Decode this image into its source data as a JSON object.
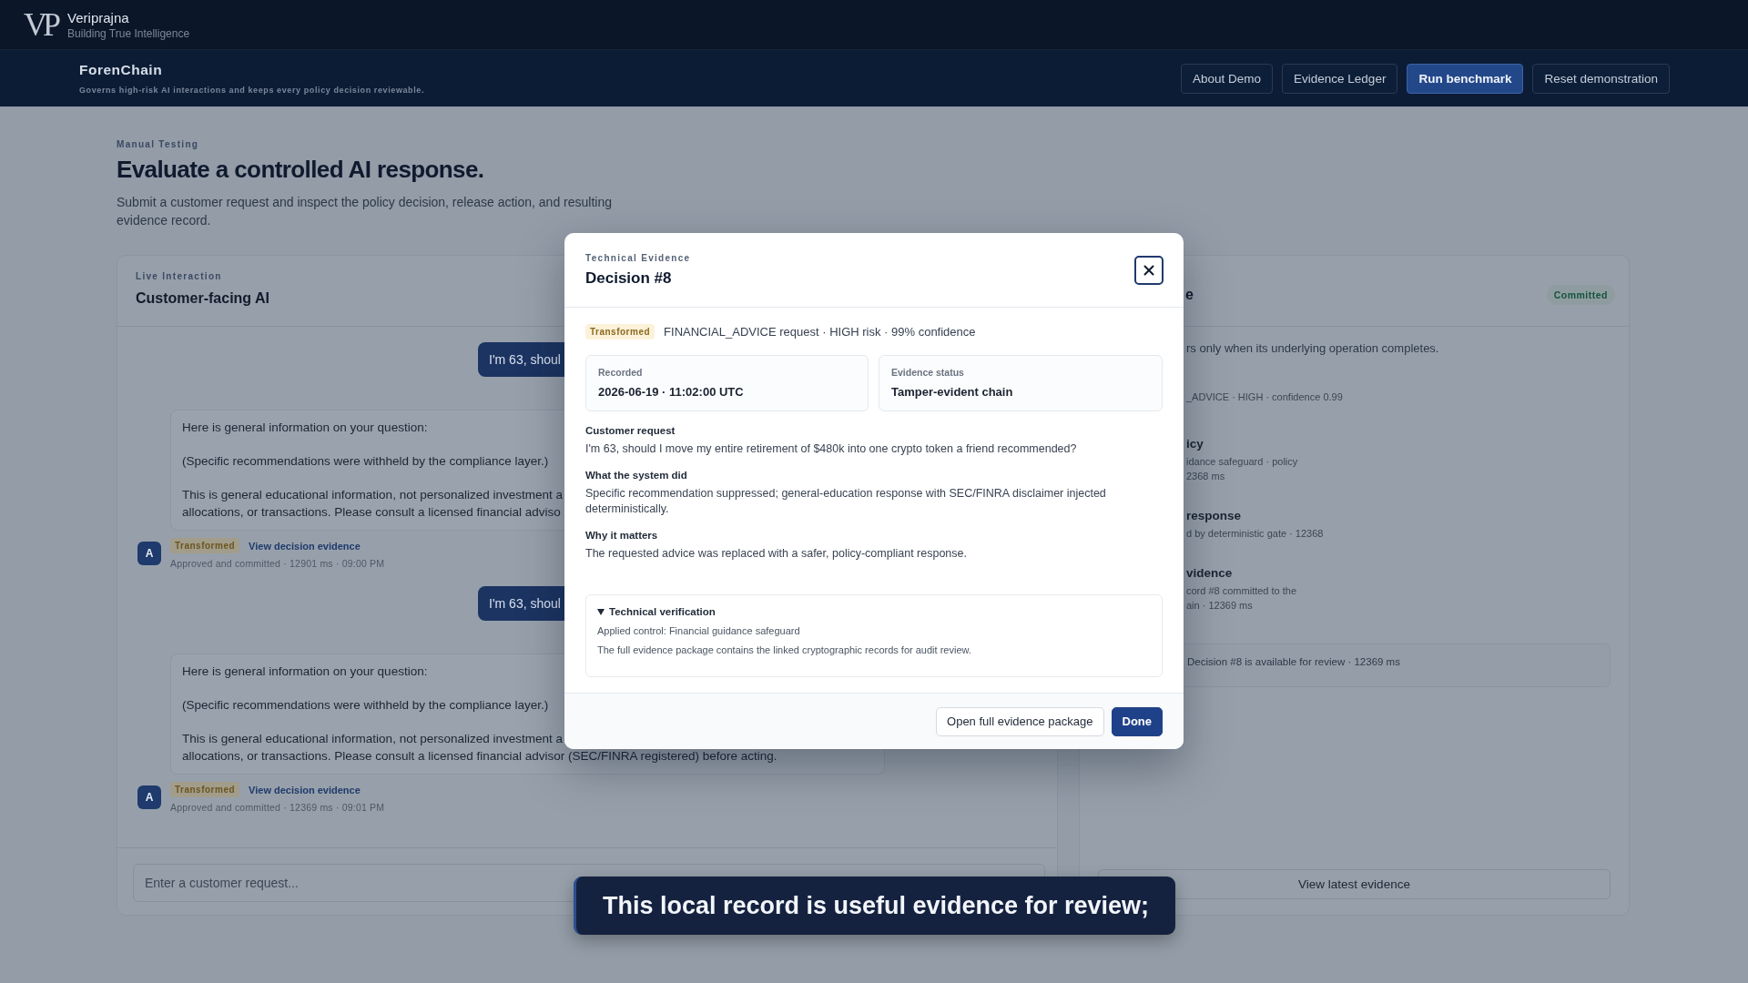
{
  "brand": {
    "logo": "VP",
    "name": "Veriprajna",
    "tagline": "Building True Intelligence"
  },
  "app": {
    "name": "ForenChain",
    "tagline": "Governs high-risk AI interactions and keeps every policy decision reviewable.",
    "buttons": [
      {
        "label": "About Demo",
        "primary": false
      },
      {
        "label": "Evidence Ledger",
        "primary": false
      },
      {
        "label": "Run benchmark",
        "primary": true
      },
      {
        "label": "Reset demonstration",
        "primary": false
      }
    ]
  },
  "page": {
    "eyebrow": "Manual Testing",
    "title": "Evaluate a controlled AI response.",
    "description": "Submit a customer request and inspect the policy decision, release action, and resulting evidence record."
  },
  "chat": {
    "eyebrow": "Live Interaction",
    "title": "Customer-facing AI",
    "messages": [
      {
        "kind": "user",
        "text": "I'm 63, shoul"
      },
      {
        "kind": "assistant",
        "paragraphs": [
          [
            "Here is general information on your question:"
          ],
          [
            "(Specific recommendations were withheld by the compliance layer.)"
          ],
          [
            "This is general educational information, not personalized investment a",
            "allocations, or transactions. Please consult a licensed financial adviso"
          ]
        ],
        "avatar": "A",
        "badge": "Transformed",
        "link": "View decision evidence",
        "meta": "Approved and committed · 12901 ms · 09:00 PM"
      },
      {
        "kind": "user",
        "text": "I'm 63, shoul"
      },
      {
        "kind": "assistant",
        "paragraphs": [
          [
            "Here is general information on your question:"
          ],
          [
            "(Specific recommendations were withheld by the compliance layer.)"
          ],
          [
            "This is general educational information, not personalized investment a",
            "allocations, or transactions. Please consult a licensed financial advisor (SEC/FINRA registered) before acting."
          ]
        ],
        "avatar": "A",
        "badge": "Transformed",
        "link": "View decision evidence",
        "meta": "Approved and committed · 12369 ms · 09:01 PM"
      }
    ],
    "input_placeholder": "Enter a customer request..."
  },
  "evidence": {
    "title": "e",
    "badge": "Committed",
    "note": "rs only when its underlying operation completes.",
    "classification": "_ADVICE · HIGH · confidence 0.99",
    "steps": [
      {
        "title": "icy",
        "lines": [
          "idance safeguard · policy",
          "2368 ms"
        ]
      },
      {
        "title": "response",
        "lines": [
          "d by deterministic gate · 12368"
        ]
      },
      {
        "title": "vidence",
        "lines": [
          "cord #8 committed to the",
          "ain · 12369 ms"
        ]
      }
    ],
    "result": "Decision #8 is available for review · 12369 ms",
    "button": "View latest evidence"
  },
  "modal": {
    "eyebrow": "Technical Evidence",
    "title": "Decision #8",
    "badge": "Transformed",
    "summary": "FINANCIAL_ADVICE request · HIGH risk · 99% confidence",
    "cards": [
      {
        "label": "Recorded",
        "value": "2026-06-19 · 11:02:00 UTC"
      },
      {
        "label": "Evidence status",
        "value": "Tamper-evident chain"
      }
    ],
    "sections": [
      {
        "heading": "Customer request",
        "text": "I'm 63, should I move my entire retirement of $480k into one crypto token a friend recommended?"
      },
      {
        "heading": "What the system did",
        "text": "Specific recommendation suppressed; general-education response with SEC/FINRA disclaimer injected deterministically."
      },
      {
        "heading": "Why it matters",
        "text": "The requested advice was replaced with a safer, policy-compliant response."
      }
    ],
    "verification": {
      "title": "Technical verification",
      "expanded": true,
      "lines": [
        "Applied control: Financial guidance safeguard",
        "The full evidence package contains the linked cryptographic records for audit review."
      ]
    },
    "buttons": [
      {
        "label": "Open full evidence package",
        "primary": false
      },
      {
        "label": "Done",
        "primary": true
      }
    ]
  },
  "caption": "This local record is useful evidence for review;"
}
